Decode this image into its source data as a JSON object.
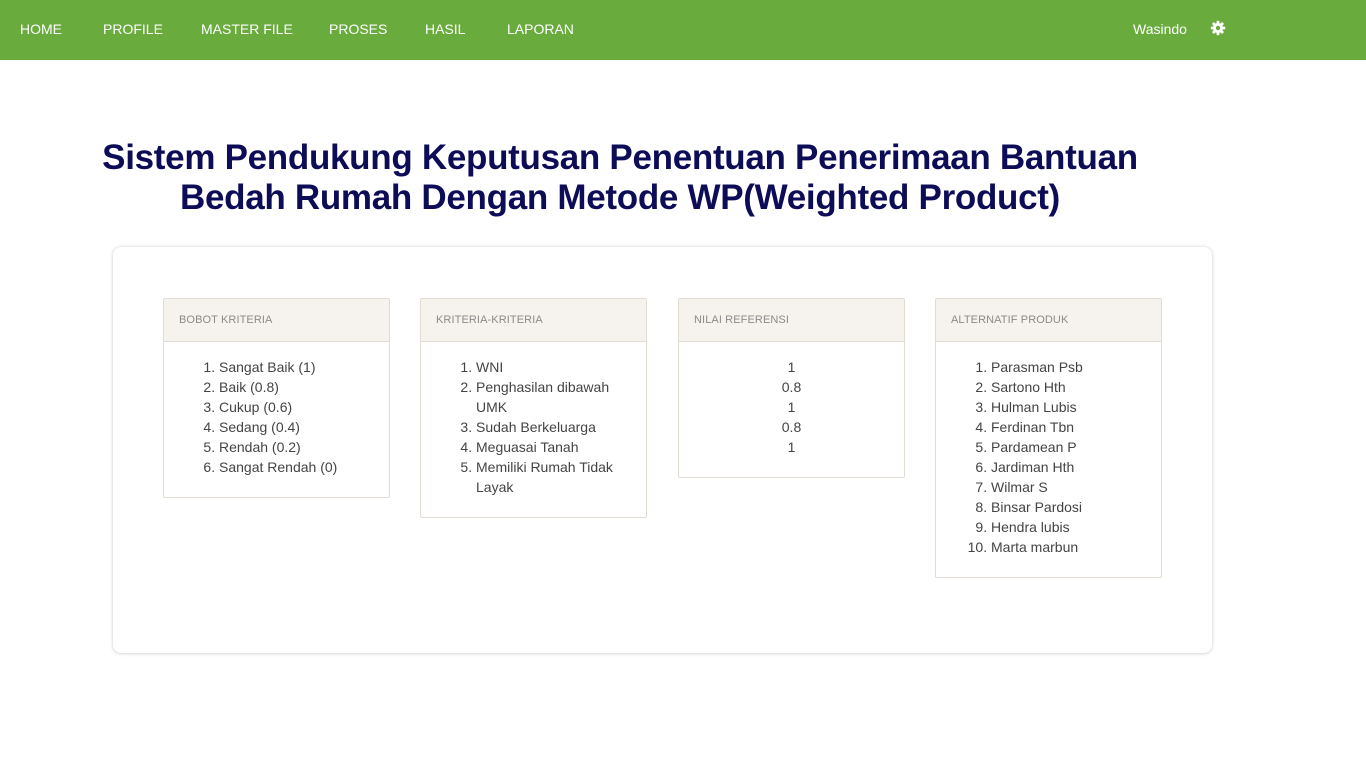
{
  "nav": {
    "home": "HOME",
    "profile": "PROFILE",
    "master_file": "MASTER FILE",
    "proses": "PROSES",
    "hasil": "HASIL",
    "laporan": "LAPORAN",
    "user": "Wasindo",
    "settings_icon": "gear-icon"
  },
  "title": {
    "line1": "Sistem Pendukung Keputusan Penentuan Penerimaan Bantuan",
    "line2": "Bedah Rumah Dengan Metode WP(Weighted Product)"
  },
  "panels": {
    "bobot": {
      "heading": "BOBOT KRITERIA",
      "items": [
        "Sangat Baik (1)",
        "Baik (0.8)",
        "Cukup (0.6)",
        "Sedang (0.4)",
        "Rendah (0.2)",
        "Sangat Rendah (0)"
      ]
    },
    "kriteria": {
      "heading": "KRITERIA-KRITERIA",
      "items": [
        "WNI",
        "Penghasilan dibawah UMK",
        "Sudah Berkeluarga",
        "Meguasai Tanah",
        "Memiliki Rumah Tidak Layak"
      ]
    },
    "nilai": {
      "heading": "NILAI REFERENSI",
      "items": [
        "1",
        "0.8",
        "1",
        "0.8",
        "1"
      ]
    },
    "alternatif": {
      "heading": "ALTERNATIF PRODUK",
      "items": [
        "Parasman Psb",
        "Sartono Hth",
        "Hulman Lubis",
        "Ferdinan Tbn",
        "Pardamean P",
        "Jardiman Hth",
        "Wilmar S",
        "Binsar Pardosi",
        "Hendra lubis",
        "Marta marbun"
      ]
    }
  },
  "colors": {
    "navbar": "#69ab3d",
    "title": "#0c0c57",
    "panel_header_bg": "#f6f3ee"
  }
}
